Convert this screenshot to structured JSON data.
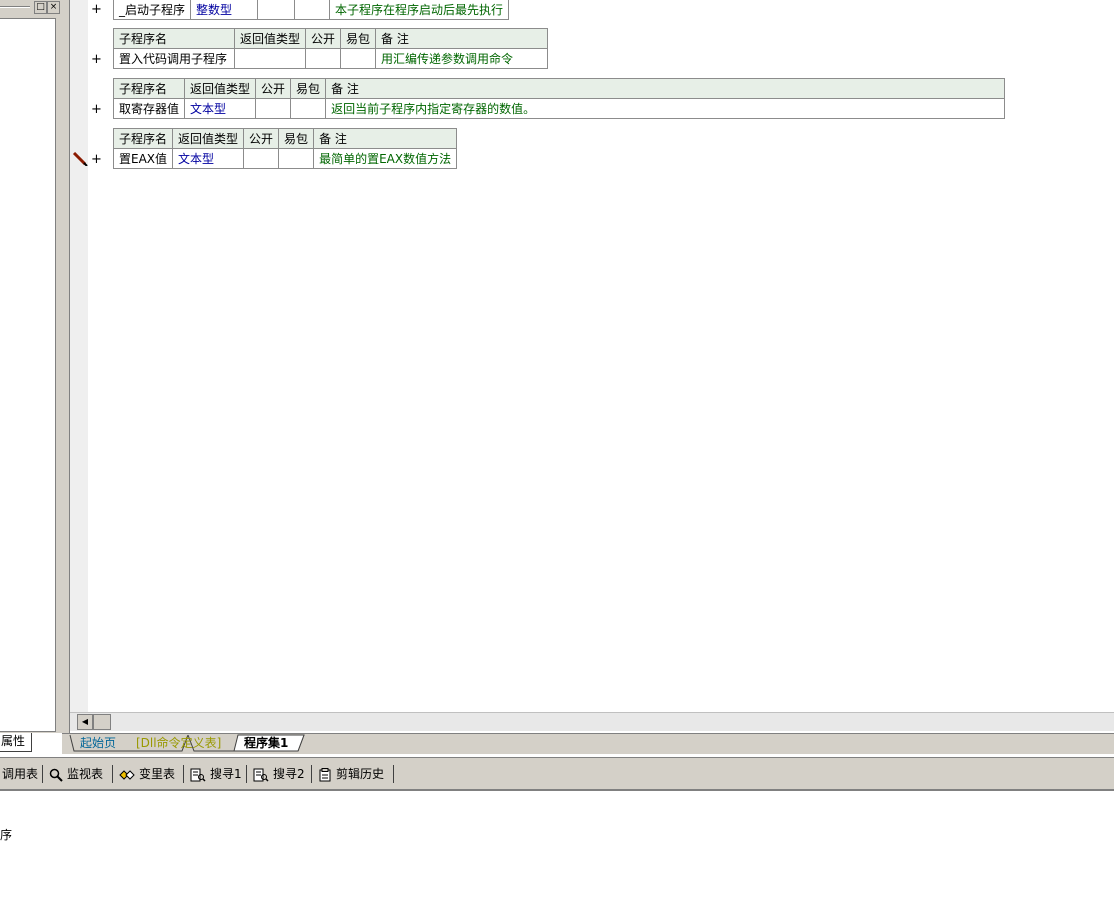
{
  "left_panel": {
    "prop_tab_label": "属性"
  },
  "tables": [
    {
      "row": {
        "name": "_启动子程序",
        "return_type": "整数型",
        "public": "",
        "easy_pack": "",
        "note": "本子程序在程序启动后最先执行"
      }
    },
    {
      "header": {
        "name": "子程序名",
        "return_type": "返回值类型",
        "public": "公开",
        "easy_pack": "易包",
        "note": "备 注"
      },
      "row": {
        "name": "置入代码调用子程序",
        "return_type": "",
        "public": "",
        "easy_pack": "",
        "note": "用汇编传递参数调用命令"
      }
    },
    {
      "header": {
        "name": "子程序名",
        "return_type": "返回值类型",
        "public": "公开",
        "easy_pack": "易包",
        "note": "备 注"
      },
      "row": {
        "name": "取寄存器值",
        "return_type": "文本型",
        "public": "",
        "easy_pack": "",
        "note": "返回当前子程序内指定寄存器的数值。"
      }
    },
    {
      "header": {
        "name": "子程序名",
        "return_type": "返回值类型",
        "public": "公开",
        "easy_pack": "易包",
        "note": "备 注"
      },
      "row": {
        "name": "置EAX值",
        "return_type": "文本型",
        "public": "",
        "easy_pack": "",
        "note": "最简单的置EAX数值方法"
      }
    }
  ],
  "plus_sign": "+",
  "doc_tabs": [
    {
      "label": "起始页"
    },
    {
      "label": "[Dll命令定义表]"
    },
    {
      "label": "程序集1"
    }
  ],
  "bottom_toolbar": [
    {
      "label": "调用表",
      "icon": "call-table-icon"
    },
    {
      "label": "监视表",
      "icon": "magnifier-icon"
    },
    {
      "label": "变里表",
      "icon": "variable-icon"
    },
    {
      "label": "搜寻1",
      "icon": "search-doc-icon"
    },
    {
      "label": "搜寻2",
      "icon": "search-doc-icon"
    },
    {
      "label": "剪辑历史",
      "icon": "clipboard-icon"
    }
  ],
  "output": {
    "text": "序"
  }
}
